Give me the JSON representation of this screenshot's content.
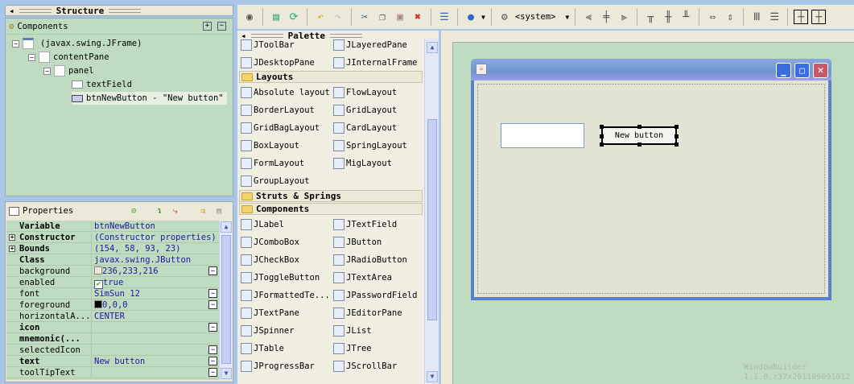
{
  "structure": {
    "title": "Structure",
    "components_label": "Components",
    "tree": [
      "(javax.swing.JFrame)",
      "contentPane",
      "panel",
      "textField",
      "btnNewButton - \"New button\""
    ]
  },
  "properties": {
    "title": "Properties",
    "rows": [
      {
        "key": "Variable",
        "value": "btnNewButton",
        "bold": true
      },
      {
        "key": "Constructor",
        "value": "(Constructor properties)",
        "bold": true,
        "expand": true
      },
      {
        "key": "Bounds",
        "value": "(154, 58, 93, 23)",
        "bold": true,
        "expand": true
      },
      {
        "key": "Class",
        "value": "javax.swing.JButton",
        "bold": true
      },
      {
        "key": "background",
        "value": "236,233,216",
        "swatch": "#ece9d8",
        "dots": true
      },
      {
        "key": "enabled",
        "value": "true",
        "check": true
      },
      {
        "key": "font",
        "value": "SimSun 12",
        "dots": true
      },
      {
        "key": "foreground",
        "value": "0,0,0",
        "swatch": "#000000",
        "dots": true
      },
      {
        "key": "horizontalA...",
        "value": "CENTER"
      },
      {
        "key": "icon",
        "value": "",
        "bold": true,
        "dots": true
      },
      {
        "key": "mnemonic(...",
        "value": "",
        "bold": true
      },
      {
        "key": "selectedIcon",
        "value": "",
        "dots": true
      },
      {
        "key": "text",
        "value": "New button",
        "bold": true,
        "dots": true
      },
      {
        "key": "toolTipText",
        "value": "",
        "dots": true
      }
    ]
  },
  "toolbar": {
    "lnf": "<system>"
  },
  "palette": {
    "title": "Palette",
    "top": [
      "JToolBar",
      "JLayeredPane",
      "JDesktopPane",
      "JInternalFrame"
    ],
    "layouts_label": "Layouts",
    "layouts": [
      "Absolute layout",
      "FlowLayout",
      "BorderLayout",
      "GridLayout",
      "GridBagLayout",
      "CardLayout",
      "BoxLayout",
      "SpringLayout",
      "FormLayout",
      "MigLayout",
      "GroupLayout"
    ],
    "struts_label": "Struts & Springs",
    "components_label": "Components",
    "components": [
      "JLabel",
      "JTextField",
      "JComboBox",
      "JButton",
      "JCheckBox",
      "JRadioButton",
      "JToggleButton",
      "JTextArea",
      "JFormattedTe...",
      "JPasswordField",
      "JTextPane",
      "JEditorPane",
      "JSpinner",
      "JList",
      "JTable",
      "JTree",
      "JProgressBar",
      "JScrollBar"
    ]
  },
  "canvas": {
    "button_label": "New button",
    "watermark1": "WindowBuilder",
    "watermark2": "1.1.0.r37x201109091012"
  }
}
